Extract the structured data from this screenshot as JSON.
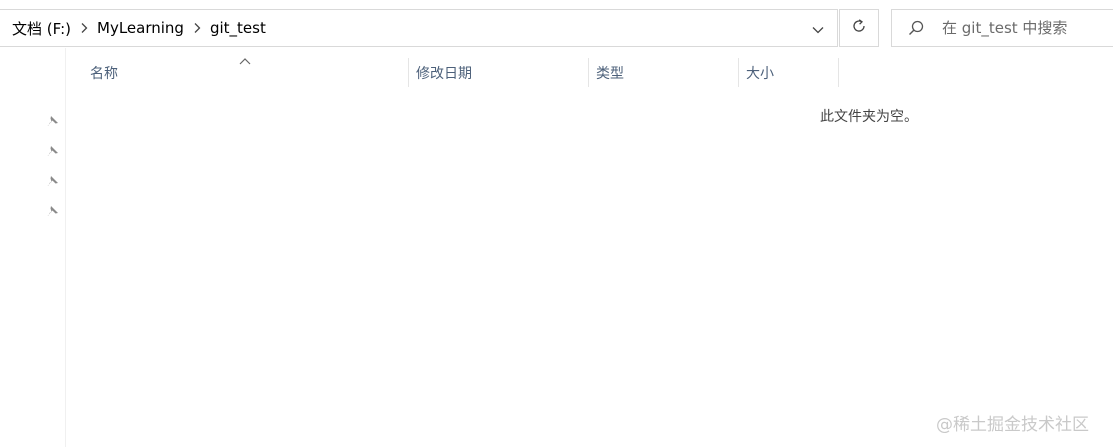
{
  "address_bar": {
    "crumbs": [
      "文档 (F:)",
      "MyLearning",
      "git_test"
    ]
  },
  "search": {
    "placeholder": "在 git_test 中搜索"
  },
  "columns": {
    "name": "名称",
    "date_modified": "修改日期",
    "type": "类型",
    "size": "大小"
  },
  "sort": {
    "column": "name",
    "direction": "ascending"
  },
  "content": {
    "empty_message": "此文件夹为空。"
  },
  "nav_pane": {
    "pinned_count": 4
  },
  "watermark": "@稀土掘金技术社区",
  "icons": {
    "separator": "chevron-right-icon",
    "dropdown": "chevron-down-icon",
    "refresh": "refresh-icon",
    "search": "search-icon",
    "pin": "pin-icon",
    "sort": "sort-ascending-icon"
  },
  "colors": {
    "column_header_text": "#4c607a",
    "border": "#d9d9d9",
    "watermark": "#c9c9c9"
  }
}
